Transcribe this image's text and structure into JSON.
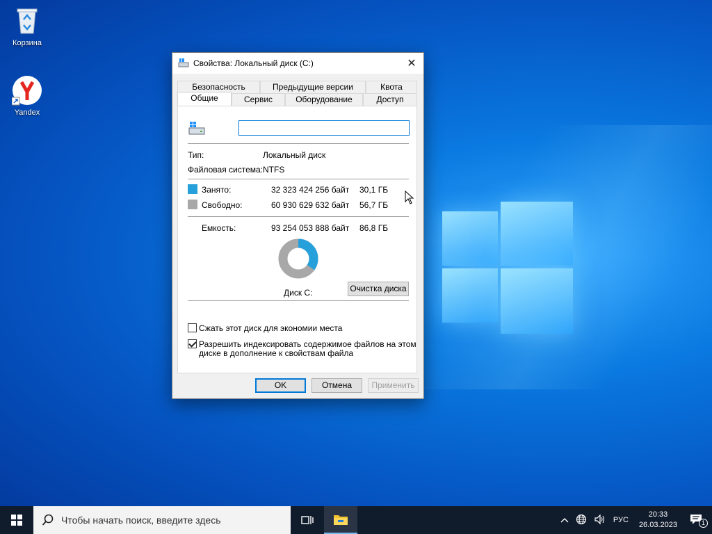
{
  "desktop": {
    "icons": [
      {
        "label": "Корзина"
      },
      {
        "label": "Yandex"
      }
    ]
  },
  "dialog": {
    "title": "Свойства: Локальный диск (C:)",
    "tabs_top": [
      "Безопасность",
      "Предыдущие версии",
      "Квота"
    ],
    "tabs_bottom": [
      "Общие",
      "Сервис",
      "Оборудование",
      "Доступ"
    ],
    "active_tab": "Общие",
    "name_value": "",
    "type_label": "Тип:",
    "type_value": "Локальный диск",
    "fs_label": "Файловая система:",
    "fs_value": "NTFS",
    "used": {
      "label": "Занято:",
      "bytes": "32 323 424 256 байт",
      "size": "30,1 ГБ",
      "color": "#26a0da"
    },
    "free": {
      "label": "Свободно:",
      "bytes": "60 930 629 632 байт",
      "size": "56,7 ГБ",
      "color": "#a8a8a8"
    },
    "capacity": {
      "label": "Емкость:",
      "bytes": "93 254 053 888 байт",
      "size": "86,8 ГБ"
    },
    "used_fraction": 0.347,
    "disk_label": "Диск C:",
    "cleanup_button": "Очистка диска",
    "compress_label": "Сжать этот диск для экономии места",
    "compress_checked": false,
    "index_label_line1": "Разрешить индексировать содержимое файлов на этом",
    "index_label_line2": "диске в дополнение к свойствам файла",
    "index_checked": true,
    "ok_button": "OK",
    "cancel_button": "Отмена",
    "apply_button": "Применить"
  },
  "taskbar": {
    "search_placeholder": "Чтобы начать поиск, введите здесь",
    "language": "РУС",
    "time": "20:33",
    "date": "26.03.2023",
    "notification_count": "1"
  }
}
